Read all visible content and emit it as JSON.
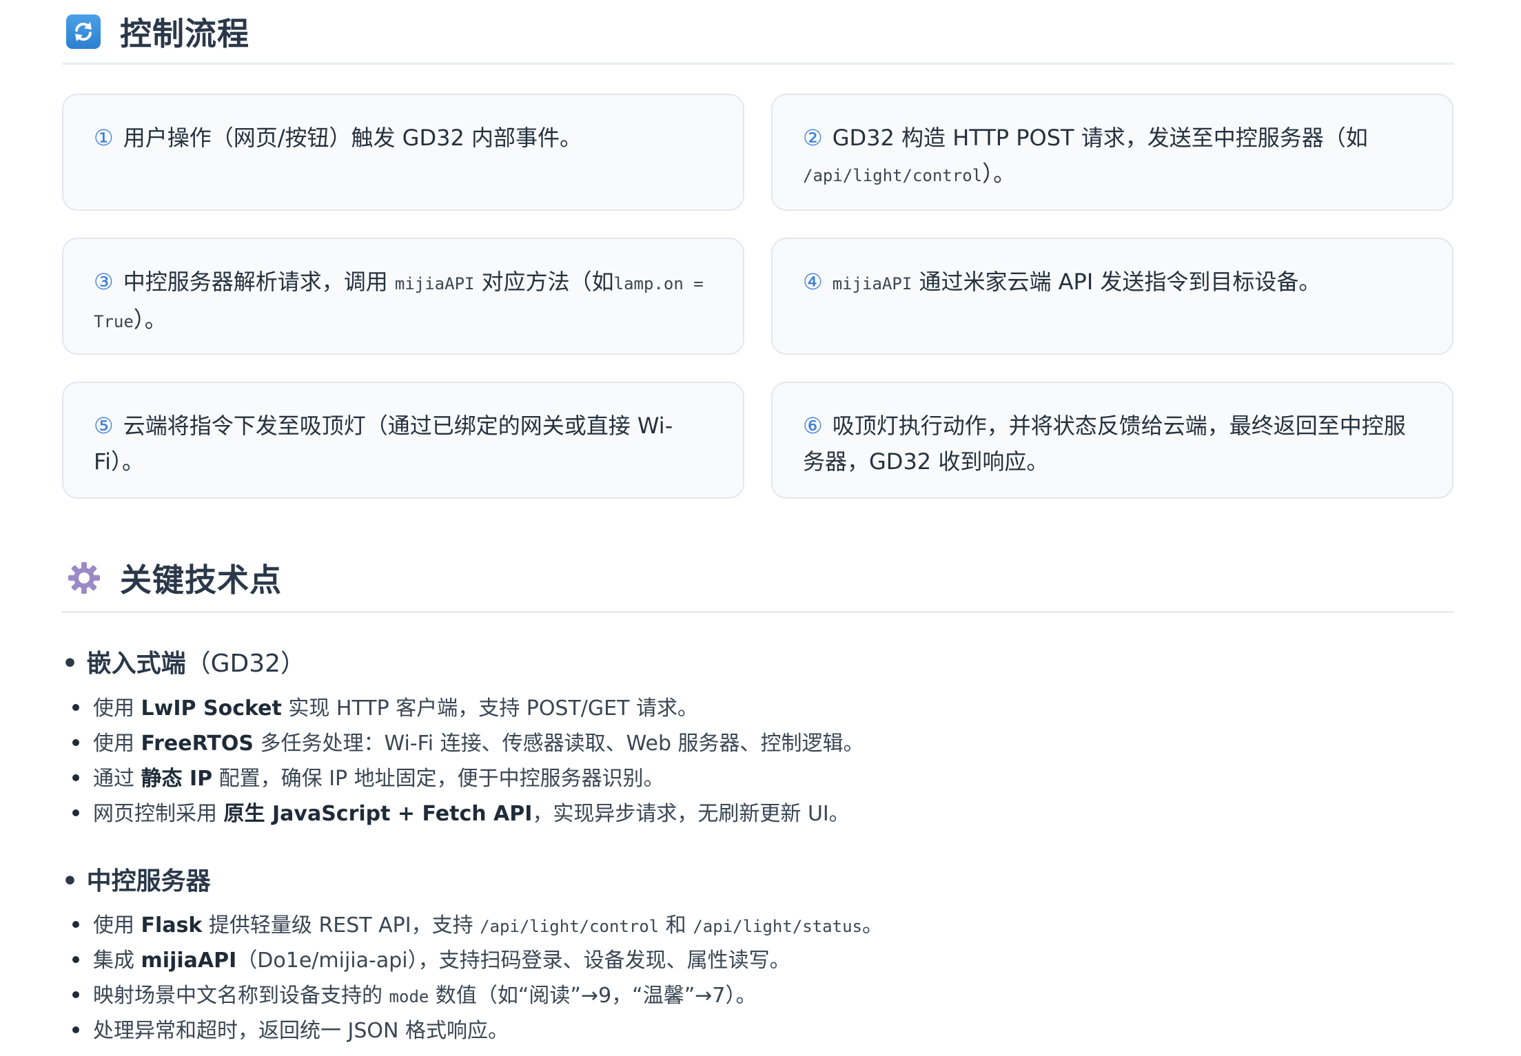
{
  "sections": {
    "flow": {
      "icon": "refresh-arrows-icon",
      "title": "控制流程"
    },
    "tech": {
      "icon": "gear-icon",
      "title": "关键技术点"
    }
  },
  "steps": [
    {
      "num": "①",
      "text": "用户操作（网页/按钮）触发 GD32 内部事件。"
    },
    {
      "num": "②",
      "pre": "GD32 构造 HTTP POST 请求，发送至中控服务器（如",
      "code": "/api/light/control",
      "post": "）。"
    },
    {
      "num": "③",
      "pre": "中控服务器解析请求，调用",
      "code": "mijiaAPI",
      "mid": "对应方法（如",
      "code2": "lamp.on =",
      "code3": "True",
      "post": "）。"
    },
    {
      "num": "④",
      "code": "mijiaAPI",
      "post": "通过米家云端 API 发送指令到目标设备。"
    },
    {
      "num": "⑤",
      "line1": "云端将指令下发至吸顶灯（通过已绑定的网关或直接 Wi-",
      "line2": "Fi）。"
    },
    {
      "num": "⑥",
      "line1": "吸顶灯执行动作，并将状态反馈给云端，最终返回至中控服",
      "line2": "务器，GD32 收到响应。"
    }
  ],
  "embedded": {
    "marker": "•",
    "title": "嵌入式端",
    "title_paren": "（GD32）",
    "items": [
      {
        "a": "使用 ",
        "b": "LwIP Socket",
        "c": " 实现 HTTP 客户端，支持 POST/GET 请求。"
      },
      {
        "a": "使用 ",
        "b": "FreeRTOS",
        "c": " 多任务处理：Wi-Fi 连接、传感器读取、Web 服务器、控制逻辑。"
      },
      {
        "a": "通过 ",
        "b": "静态 IP",
        "c": " 配置，确保 IP 地址固定，便于中控服务器识别。"
      },
      {
        "a": "网页控制采用 ",
        "b": "原生 JavaScript + Fetch API",
        "c": "，实现异步请求，无刷新更新 UI。"
      }
    ]
  },
  "server": {
    "marker": "•",
    "title": "中控服务器",
    "item1": {
      "a": "使用 ",
      "b": "Flask",
      "c": " 提供轻量级 REST API，支持 ",
      "code1": "/api/light/control",
      "d": " 和 ",
      "code2": "/api/light/status",
      "e": "。"
    },
    "item2": {
      "a": "集成 ",
      "b": "mijiaAPI",
      "c": "（Do1e/mijia-api），支持扫码登录、设备发现、属性读写。"
    },
    "item3": {
      "a": "映射场景中文名称到设备支持的 ",
      "code": "mode",
      "c": " 数值（如“阅读”→9，“温馨”→7）。"
    },
    "item4": {
      "a": "处理异常和超时，返回统一 JSON 格式响应。"
    }
  }
}
